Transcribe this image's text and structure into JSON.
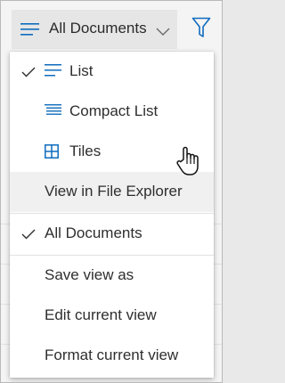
{
  "toolbar": {
    "view_label": "All Documents",
    "view_icon": "lines-icon",
    "dropdown_icon": "chevron-down-icon",
    "filter_icon": "filter-icon"
  },
  "menu": {
    "layout_items": [
      {
        "label": "List",
        "icon": "list-icon",
        "checked": true
      },
      {
        "label": "Compact List",
        "icon": "compact-list-icon",
        "checked": false
      },
      {
        "label": "Tiles",
        "icon": "tiles-icon",
        "checked": false
      }
    ],
    "explorer_item": {
      "label": "View in File Explorer",
      "hovered": true
    },
    "view_item": {
      "label": "All Documents",
      "checked": true
    },
    "actions": [
      {
        "label": "Save view as"
      },
      {
        "label": "Edit current view"
      },
      {
        "label": "Format current view"
      }
    ]
  },
  "colors": {
    "accent": "#0f6cbd",
    "text": "#2e2e2e",
    "hover": "#f0f0f0"
  }
}
